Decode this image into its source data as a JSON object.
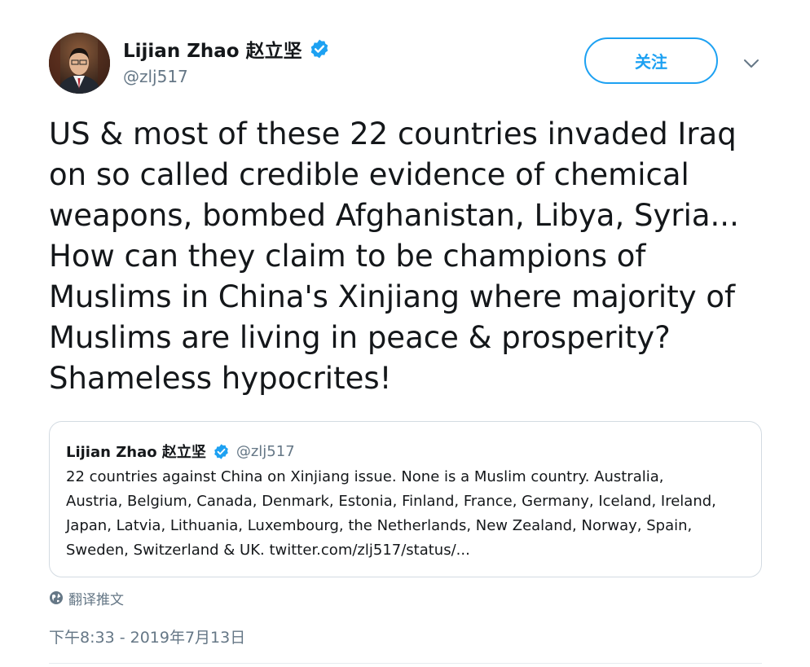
{
  "author": {
    "name": "Lijian Zhao 赵立坚",
    "handle": "@zlj517",
    "verified": true
  },
  "follow_button": {
    "label": "关注"
  },
  "menu": {
    "icon": "chevron-down-icon"
  },
  "tweet": {
    "text": "US & most of these 22 countries invaded Iraq\non so called credible evidence of chemical\nweapons, bombed Afghanistan, Libya, Syria...\nHow can they claim to be champions of\nMuslims in China's Xinjiang where majority of\nMuslims are living in peace & prosperity?\nShameless hypocrites!"
  },
  "quoted_tweet": {
    "name": "Lijian Zhao 赵立坚",
    "handle": "@zlj517",
    "text": "22 countries against China on Xinjiang issue. None is a Muslim country. Australia,\nAustria, Belgium, Canada, Denmark, Estonia, Finland, France, Germany, Iceland, Ireland,\nJapan, Latvia, Lithuania, Luxembourg, the Netherlands, New Zealand, Norway, Spain,\nSweden, Switzerland & UK. twitter.com/zlj517/status/..."
  },
  "translate": {
    "label": "翻译推文",
    "icon": "globe-icon"
  },
  "timestamp": "下午8:33 - 2019年7月13日",
  "colors": {
    "accent": "#1da1f2",
    "text_primary": "#14171a",
    "text_secondary": "#657786",
    "border": "#d3dbe2"
  }
}
